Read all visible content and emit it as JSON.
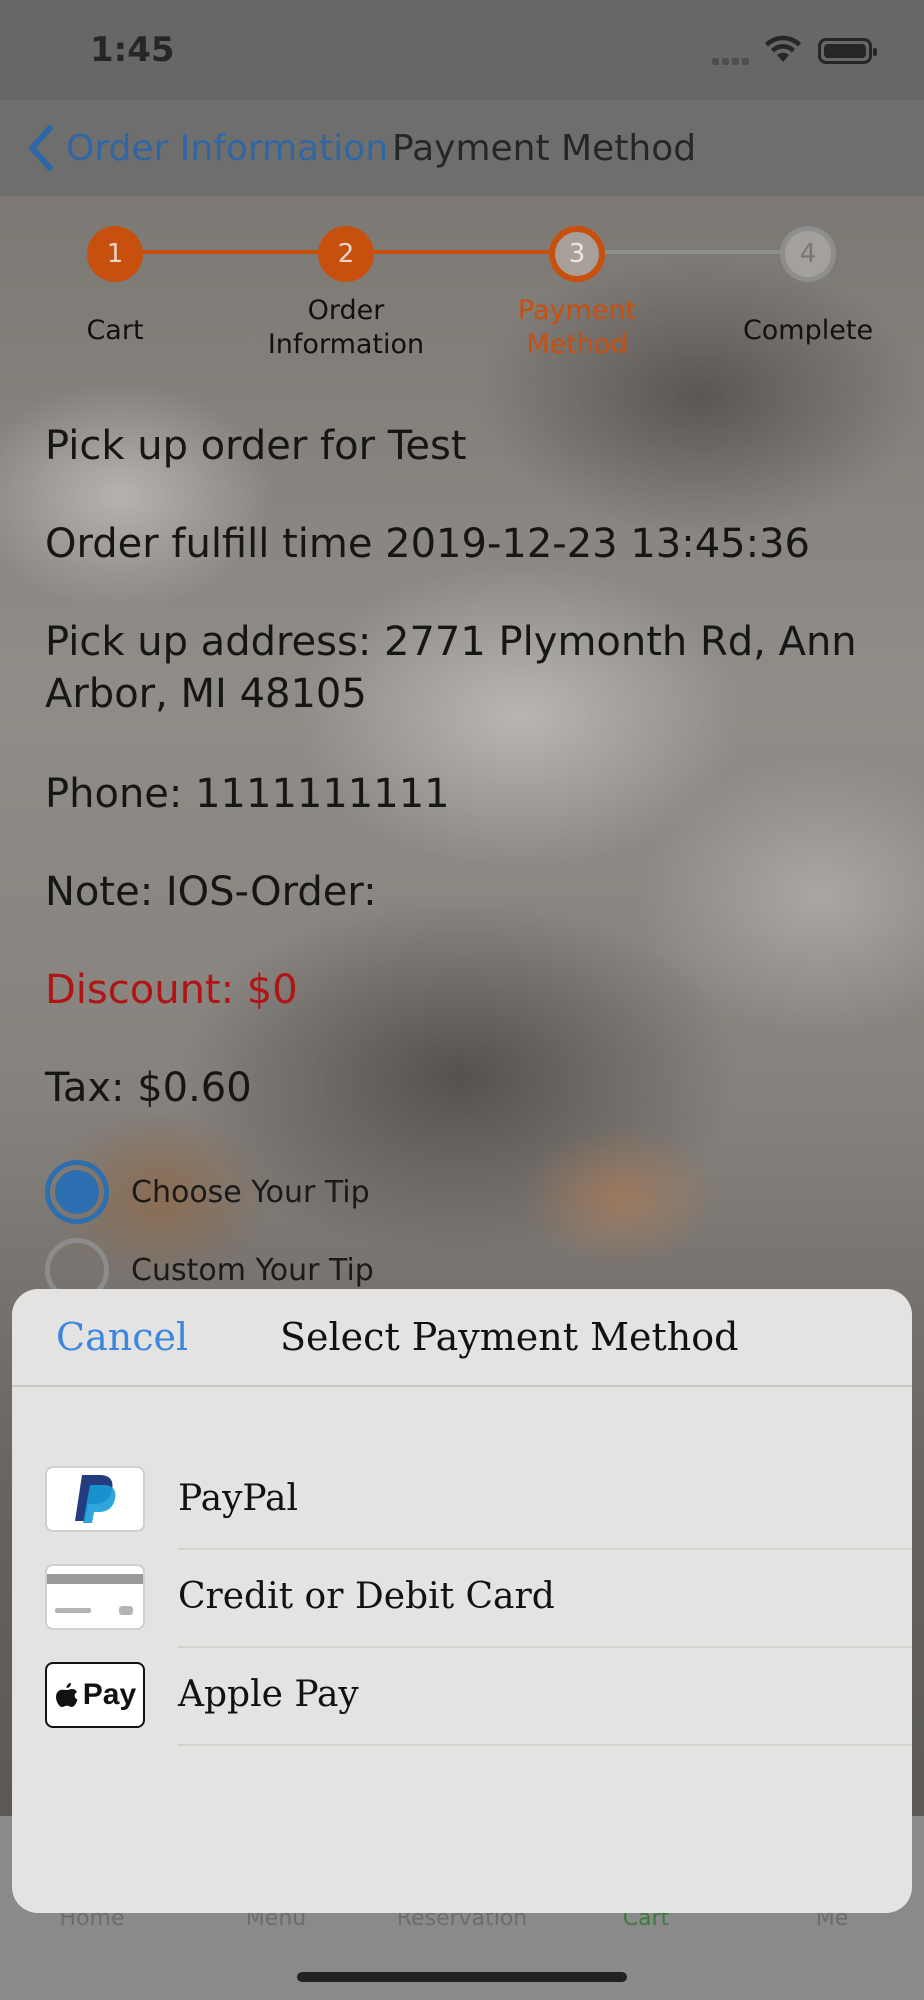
{
  "status_bar": {
    "time": "1:45"
  },
  "nav": {
    "back_label": "Order Information",
    "title": "Payment Method"
  },
  "stepper": {
    "steps": [
      {
        "number": "1",
        "label": "Cart",
        "state": "done"
      },
      {
        "number": "2",
        "label": "Order\nInformation",
        "state": "done"
      },
      {
        "number": "3",
        "label": "Payment\nMethod",
        "state": "current"
      },
      {
        "number": "4",
        "label": "Complete",
        "state": "pending"
      }
    ],
    "colors": {
      "accent": "#c8500e",
      "pending": "#8e8e8e"
    }
  },
  "order": {
    "pickup_for": "Pick up order for Test",
    "fulfill_time": "Order fulfill time 2019-12-23 13:45:36",
    "address": "Pick up address: 2771 Plymonth Rd, Ann Arbor, MI 48105",
    "phone": "Phone: 1111111111",
    "note": "Note: IOS-Order:",
    "discount": "Discount: $0",
    "tax": "Tax: $0.60"
  },
  "tip": {
    "options": [
      {
        "label": "Choose Your Tip",
        "selected": true
      },
      {
        "label": "Custom Your Tip",
        "selected": false
      }
    ]
  },
  "tab_bar": {
    "items": [
      "Home",
      "Menu",
      "Reservation",
      "Cart",
      "Me"
    ]
  },
  "sheet": {
    "cancel_label": "Cancel",
    "title": "Select Payment Method",
    "methods": [
      {
        "label": "PayPal",
        "icon": "paypal-logo"
      },
      {
        "label": "Credit or Debit Card",
        "icon": "credit-card-icon"
      },
      {
        "label": "Apple Pay",
        "icon": "apple-pay-logo",
        "logo_text": "Pay"
      }
    ]
  }
}
